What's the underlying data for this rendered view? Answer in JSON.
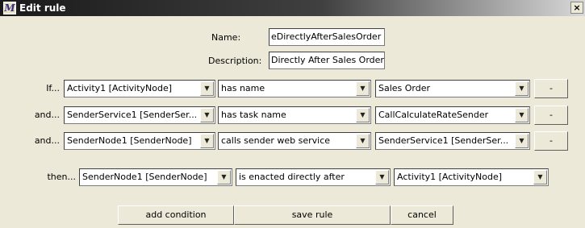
{
  "window": {
    "title": "Edit rule",
    "close_glyph": "×",
    "app_icon_glyph": "M"
  },
  "form": {
    "name_label": "Name:",
    "name_value": "eDirectlyAfterSalesOrder",
    "description_label": "Description:",
    "description_value": "Directly After Sales Order"
  },
  "conditions": [
    {
      "prefix": "If...",
      "subject": "Activity1 [ActivityNode]",
      "predicate": "has name",
      "object": "Sales Order",
      "remove_label": "-"
    },
    {
      "prefix": "and...",
      "subject": "SenderService1 [SenderSer...",
      "predicate": "has task name",
      "object": "CallCalculateRateSender",
      "remove_label": "-"
    },
    {
      "prefix": "and...",
      "subject": "SenderNode1 [SenderNode]",
      "predicate": "calls sender web service",
      "object": "SenderService1 [SenderSer...",
      "remove_label": "-"
    }
  ],
  "consequence": {
    "prefix": "then...",
    "subject": "SenderNode1 [SenderNode]",
    "predicate": "is enacted directly after",
    "object": "Activity1 [ActivityNode]"
  },
  "buttons": {
    "add_condition": "add condition",
    "save_rule": "save rule",
    "cancel": "cancel"
  },
  "icons": {
    "dropdown": "▼"
  }
}
